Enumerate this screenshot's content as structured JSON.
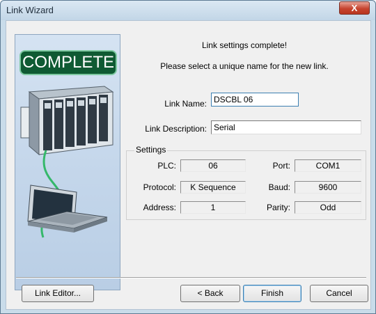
{
  "window": {
    "title": "Link Wizard",
    "close_label": "X"
  },
  "art": {
    "badge_text": "COMPLETE"
  },
  "header": {
    "line1": "Link settings complete!",
    "line2": "Please select a unique name for the new link."
  },
  "form": {
    "name_label": "Link Name:",
    "name_value": "DSCBL 06",
    "desc_label": "Link Description:",
    "desc_value": "Serial"
  },
  "settings": {
    "legend": "Settings",
    "plc_label": "PLC:",
    "plc_value": "06",
    "port_label": "Port:",
    "port_value": "COM1",
    "protocol_label": "Protocol:",
    "protocol_value": "K Sequence",
    "baud_label": "Baud:",
    "baud_value": "9600",
    "address_label": "Address:",
    "address_value": "1",
    "parity_label": "Parity:",
    "parity_value": "Odd"
  },
  "buttons": {
    "link_editor": "Link Editor...",
    "back": "< Back",
    "finish": "Finish",
    "cancel": "Cancel"
  }
}
